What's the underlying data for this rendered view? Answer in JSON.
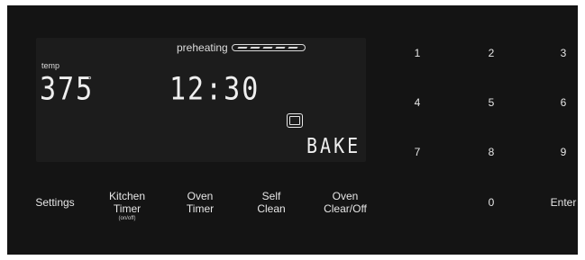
{
  "display": {
    "preheating_label": "preheating",
    "preheat_progress": 1.0,
    "temp_label": "temp",
    "temperature": "375",
    "degree_symbol": "°",
    "clock": "12:30",
    "mode": "BAKE",
    "mode_icon": "oven-icon"
  },
  "keypad": [
    "1",
    "2",
    "3",
    "4",
    "5",
    "6",
    "7",
    "8",
    "9",
    "0",
    "Enter"
  ],
  "functions": {
    "settings": "Settings",
    "kitchen_timer_line1": "Kitchen",
    "kitchen_timer_line2": "Timer",
    "kitchen_timer_sub": "(on/off)",
    "oven_timer_line1": "Oven",
    "oven_timer_line2": "Timer",
    "self_clean_line1": "Self",
    "self_clean_line2": "Clean",
    "oven_clear_line1": "Oven",
    "oven_clear_line2": "Clear/Off"
  },
  "colors": {
    "panel": "#141414",
    "display": "#1c1c1c",
    "text": "#e6e6e6"
  }
}
